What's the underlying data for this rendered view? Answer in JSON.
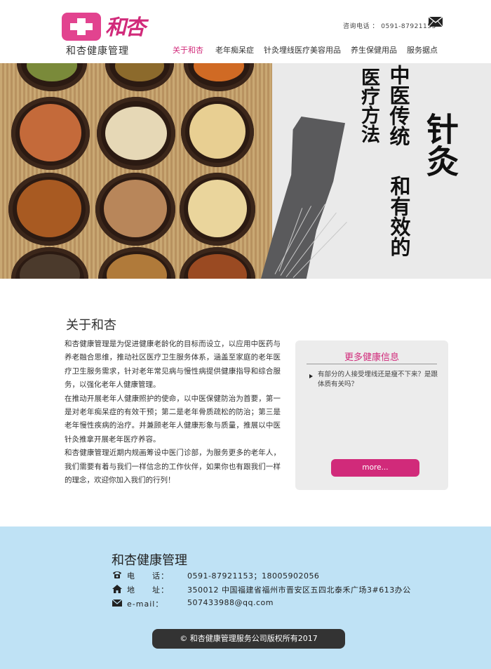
{
  "brand": {
    "logo_script": "和杏",
    "name": "和杏健康管理"
  },
  "header": {
    "contact_label": "咨询电话 ：",
    "contact_phone": "0591-87921153"
  },
  "nav": {
    "items": [
      {
        "label": "关于和杏",
        "active": true
      },
      {
        "label": "老年痴呆症",
        "active": false
      },
      {
        "label": "针灸埋线医疗美容用品",
        "active": false
      },
      {
        "label": "养生保健用品",
        "active": false
      },
      {
        "label": "服务据点",
        "active": false
      }
    ]
  },
  "hero": {
    "calligraphy_col1": "医疗方法",
    "calligraphy_col2": "中医传统",
    "calligraphy_col3": "和有效的",
    "calligraphy_col4": "针灸"
  },
  "about": {
    "title": "关于和杏",
    "paragraphs": [
      "和杏健康管理是为促进健康老龄化的目标而设立，以应用中医药与养老融合思维，推动社区医疗卫生服务体系，涵盖至家庭的老年医疗卫生服务需求，针对老年常见病与慢性病提供健康指导和综合服务，以强化老年人健康管理。",
      "在推动开展老年人健康照护的使命，以中医保健防治为首要，第一是对老年痴呆症的有效干预；第二是老年骨质疏松的防治；第三是老年慢性疾病的治疗。并兼顾老年人健康形象与质量，推展以中医针灸推拿开展老年医疗养容。",
      "和杏健康管理近期内规画筹设中医门诊部，为服务更多的老年人，我们需要有着与我们一样信念的工作伙伴，如果你也有跟我们一样的理念，欢迎你加入我们的行列！"
    ]
  },
  "sidebar": {
    "title": "更多健康信息",
    "items": [
      {
        "text": "有部分的人接受埋线还是瘦不下来？是跟体质有关吗？"
      }
    ],
    "more_label": "more..."
  },
  "footer": {
    "title": "和杏健康管理",
    "rows": [
      {
        "icon": "phone-icon",
        "label": "电　　话：",
        "value": "0591-87921153；18005902056"
      },
      {
        "icon": "home-icon",
        "label": "地　　址：",
        "value": "350012 中国福建省福州市晋安区五四北泰禾广场3#613办公"
      },
      {
        "icon": "mail-icon",
        "label": "e-mail：",
        "value": "507433988@qq.com"
      }
    ],
    "copyright": "©  和杏健康管理服务公司版权所有2017"
  },
  "colors": {
    "accent": "#d12a7a",
    "footer_bg": "#bfe2f5",
    "sidebar_bg": "#ececec"
  }
}
